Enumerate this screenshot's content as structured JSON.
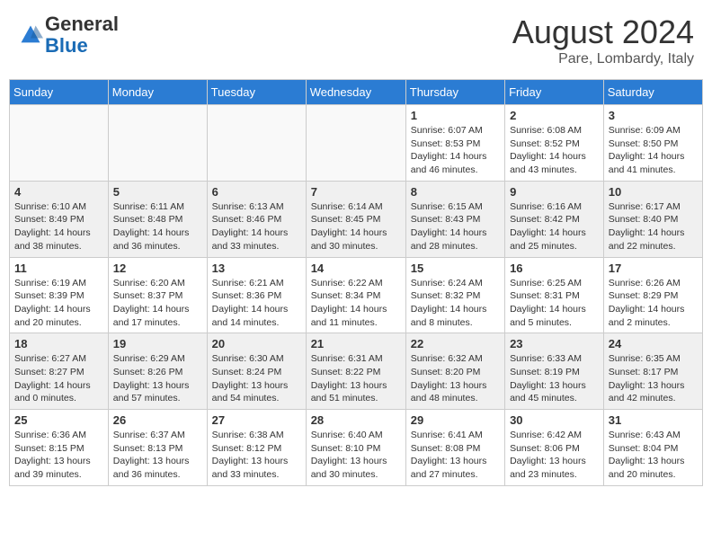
{
  "header": {
    "logo_general": "General",
    "logo_blue": "Blue",
    "month_year": "August 2024",
    "location": "Pare, Lombardy, Italy"
  },
  "days_of_week": [
    "Sunday",
    "Monday",
    "Tuesday",
    "Wednesday",
    "Thursday",
    "Friday",
    "Saturday"
  ],
  "weeks": [
    [
      {
        "day": "",
        "info": ""
      },
      {
        "day": "",
        "info": ""
      },
      {
        "day": "",
        "info": ""
      },
      {
        "day": "",
        "info": ""
      },
      {
        "day": "1",
        "info": "Sunrise: 6:07 AM\nSunset: 8:53 PM\nDaylight: 14 hours and 46 minutes."
      },
      {
        "day": "2",
        "info": "Sunrise: 6:08 AM\nSunset: 8:52 PM\nDaylight: 14 hours and 43 minutes."
      },
      {
        "day": "3",
        "info": "Sunrise: 6:09 AM\nSunset: 8:50 PM\nDaylight: 14 hours and 41 minutes."
      }
    ],
    [
      {
        "day": "4",
        "info": "Sunrise: 6:10 AM\nSunset: 8:49 PM\nDaylight: 14 hours and 38 minutes."
      },
      {
        "day": "5",
        "info": "Sunrise: 6:11 AM\nSunset: 8:48 PM\nDaylight: 14 hours and 36 minutes."
      },
      {
        "day": "6",
        "info": "Sunrise: 6:13 AM\nSunset: 8:46 PM\nDaylight: 14 hours and 33 minutes."
      },
      {
        "day": "7",
        "info": "Sunrise: 6:14 AM\nSunset: 8:45 PM\nDaylight: 14 hours and 30 minutes."
      },
      {
        "day": "8",
        "info": "Sunrise: 6:15 AM\nSunset: 8:43 PM\nDaylight: 14 hours and 28 minutes."
      },
      {
        "day": "9",
        "info": "Sunrise: 6:16 AM\nSunset: 8:42 PM\nDaylight: 14 hours and 25 minutes."
      },
      {
        "day": "10",
        "info": "Sunrise: 6:17 AM\nSunset: 8:40 PM\nDaylight: 14 hours and 22 minutes."
      }
    ],
    [
      {
        "day": "11",
        "info": "Sunrise: 6:19 AM\nSunset: 8:39 PM\nDaylight: 14 hours and 20 minutes."
      },
      {
        "day": "12",
        "info": "Sunrise: 6:20 AM\nSunset: 8:37 PM\nDaylight: 14 hours and 17 minutes."
      },
      {
        "day": "13",
        "info": "Sunrise: 6:21 AM\nSunset: 8:36 PM\nDaylight: 14 hours and 14 minutes."
      },
      {
        "day": "14",
        "info": "Sunrise: 6:22 AM\nSunset: 8:34 PM\nDaylight: 14 hours and 11 minutes."
      },
      {
        "day": "15",
        "info": "Sunrise: 6:24 AM\nSunset: 8:32 PM\nDaylight: 14 hours and 8 minutes."
      },
      {
        "day": "16",
        "info": "Sunrise: 6:25 AM\nSunset: 8:31 PM\nDaylight: 14 hours and 5 minutes."
      },
      {
        "day": "17",
        "info": "Sunrise: 6:26 AM\nSunset: 8:29 PM\nDaylight: 14 hours and 2 minutes."
      }
    ],
    [
      {
        "day": "18",
        "info": "Sunrise: 6:27 AM\nSunset: 8:27 PM\nDaylight: 14 hours and 0 minutes."
      },
      {
        "day": "19",
        "info": "Sunrise: 6:29 AM\nSunset: 8:26 PM\nDaylight: 13 hours and 57 minutes."
      },
      {
        "day": "20",
        "info": "Sunrise: 6:30 AM\nSunset: 8:24 PM\nDaylight: 13 hours and 54 minutes."
      },
      {
        "day": "21",
        "info": "Sunrise: 6:31 AM\nSunset: 8:22 PM\nDaylight: 13 hours and 51 minutes."
      },
      {
        "day": "22",
        "info": "Sunrise: 6:32 AM\nSunset: 8:20 PM\nDaylight: 13 hours and 48 minutes."
      },
      {
        "day": "23",
        "info": "Sunrise: 6:33 AM\nSunset: 8:19 PM\nDaylight: 13 hours and 45 minutes."
      },
      {
        "day": "24",
        "info": "Sunrise: 6:35 AM\nSunset: 8:17 PM\nDaylight: 13 hours and 42 minutes."
      }
    ],
    [
      {
        "day": "25",
        "info": "Sunrise: 6:36 AM\nSunset: 8:15 PM\nDaylight: 13 hours and 39 minutes."
      },
      {
        "day": "26",
        "info": "Sunrise: 6:37 AM\nSunset: 8:13 PM\nDaylight: 13 hours and 36 minutes."
      },
      {
        "day": "27",
        "info": "Sunrise: 6:38 AM\nSunset: 8:12 PM\nDaylight: 13 hours and 33 minutes."
      },
      {
        "day": "28",
        "info": "Sunrise: 6:40 AM\nSunset: 8:10 PM\nDaylight: 13 hours and 30 minutes."
      },
      {
        "day": "29",
        "info": "Sunrise: 6:41 AM\nSunset: 8:08 PM\nDaylight: 13 hours and 27 minutes."
      },
      {
        "day": "30",
        "info": "Sunrise: 6:42 AM\nSunset: 8:06 PM\nDaylight: 13 hours and 23 minutes."
      },
      {
        "day": "31",
        "info": "Sunrise: 6:43 AM\nSunset: 8:04 PM\nDaylight: 13 hours and 20 minutes."
      }
    ]
  ]
}
